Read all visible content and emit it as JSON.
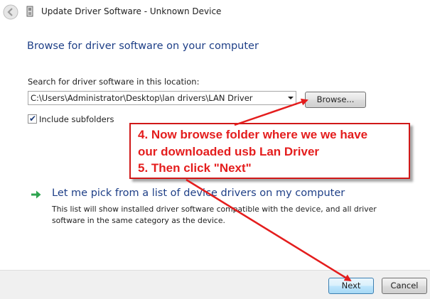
{
  "window": {
    "title": "Update Driver Software - Unknown Device"
  },
  "icons": {
    "back": "back-arrow-icon",
    "device": "device-icon",
    "pick": "green-arrow-icon"
  },
  "main": {
    "heading": "Browse for driver software on your computer",
    "search_label": "Search for driver software in this location:",
    "path_value": "C:\\Users\\Administrator\\Desktop\\lan drivers\\LAN Driver",
    "browse_label": "Browse...",
    "include_subfolders": {
      "label": "Include subfolders",
      "checked": true
    },
    "pick_link": "Let me pick from a list of device drivers on my computer",
    "pick_description": "This list will show installed driver software compatible with the device, and all driver software in the same category as the device."
  },
  "annotation": {
    "lines": [
      "4. Now browse folder where we we have",
      "our downloaded usb Lan Driver",
      "5. Then click \"Next\""
    ],
    "color": "#e41d1d"
  },
  "footer": {
    "next_label": "Next",
    "cancel_label": "Cancel"
  }
}
